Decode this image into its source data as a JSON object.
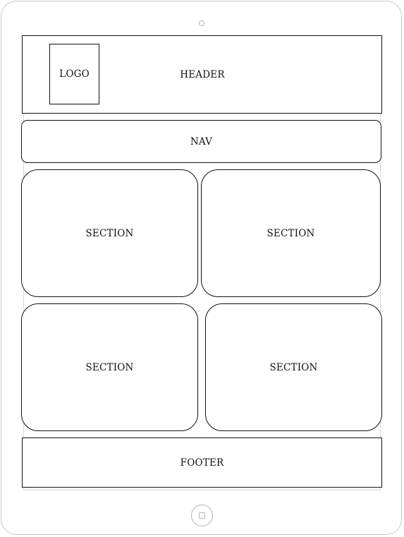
{
  "header": {
    "label": "HEADER"
  },
  "logo": {
    "label": "LOGO"
  },
  "nav": {
    "label": "NAV"
  },
  "sections": [
    {
      "label": "SECTION"
    },
    {
      "label": "SECTION"
    },
    {
      "label": "SECTION"
    },
    {
      "label": "SECTION"
    }
  ],
  "footer": {
    "label": "FOOTER"
  },
  "colors": {
    "outline": "#111111",
    "device_bezel": "#c8c8c8",
    "background": "#ffffff"
  }
}
